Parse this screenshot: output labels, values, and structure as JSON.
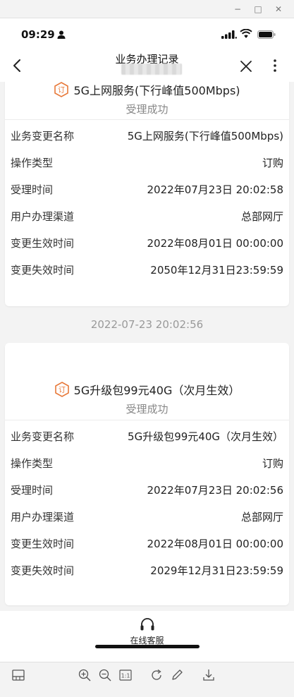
{
  "window": {
    "minimize_glyph": "−",
    "maximize_glyph": "□",
    "close_glyph": "✕"
  },
  "status_bar": {
    "time": "09:29"
  },
  "nav": {
    "title": "业务办理记录"
  },
  "records": [
    {
      "service_name": "5G上网服务(下行峰值500Mbps)",
      "status": "受理成功",
      "fields": [
        {
          "label": "业务变更名称",
          "value": "5G上网服务(下行峰值500Mbps)"
        },
        {
          "label": "操作类型",
          "value": "订购"
        },
        {
          "label": "受理时间",
          "value": "2022年07月23日 20:02:58"
        },
        {
          "label": "用户办理渠道",
          "value": "总部网厅"
        },
        {
          "label": "变更生效时间",
          "value": "2022年08月01日 00:00:00"
        },
        {
          "label": "变更失效时间",
          "value": "2050年12月31日23:59:59"
        }
      ]
    },
    {
      "timestamp": "2022-07-23 20:02:56",
      "service_name": "5G升级包99元40G（次月生效）",
      "status": "受理成功",
      "fields": [
        {
          "label": "业务变更名称",
          "value": "5G升级包99元40G（次月生效）"
        },
        {
          "label": "操作类型",
          "value": "订购"
        },
        {
          "label": "受理时间",
          "value": "2022年07月23日 20:02:56"
        },
        {
          "label": "用户办理渠道",
          "value": "总部网厅"
        },
        {
          "label": "变更生效时间",
          "value": "2022年08月01日 00:00:00"
        },
        {
          "label": "变更失效时间",
          "value": "2029年12月31日23:59:59"
        }
      ]
    }
  ],
  "customer_service": {
    "label": "在线客服"
  },
  "icons": {
    "service_badge": "order-badge-icon",
    "accent_color": "#e8793a"
  },
  "toolbar": {
    "actual_size_label": "1:1"
  }
}
